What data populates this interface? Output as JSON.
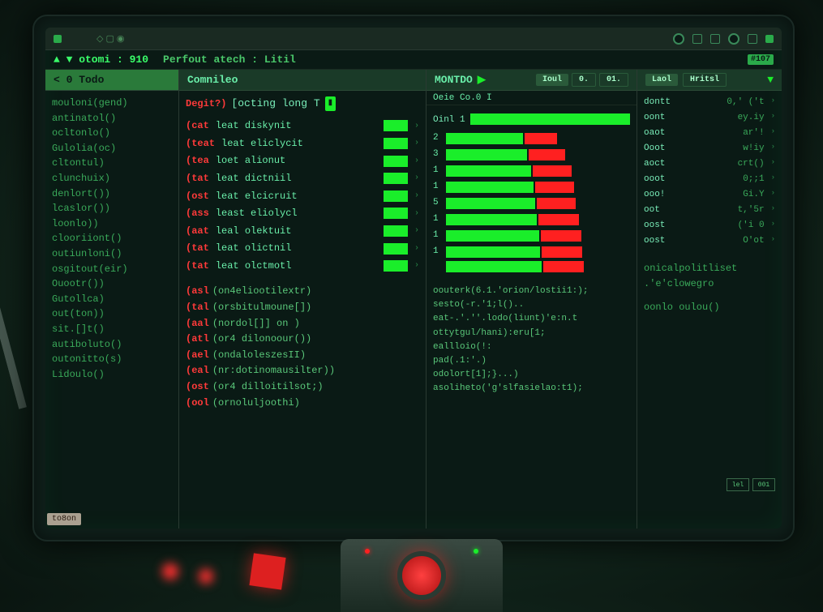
{
  "titlebar": {
    "icons": [
      "◇",
      "▢",
      "◉"
    ]
  },
  "statusbar": {
    "left": "▲ ▼ otomi : 910",
    "center": "Perfout atech : Litil",
    "badge": "#107"
  },
  "sidebar": {
    "header": "< 0 Todo",
    "items": [
      "mouloni(gend)",
      "antinatol()",
      "ocltonlo()",
      "Gulolia(oc)",
      "cltontul)",
      "clunchuix)",
      "denlort())",
      "lcaslor())",
      "loonlo))",
      "clooriiont()",
      "outiunloni()",
      "osgitout(eir)",
      "Ouootr())",
      "Gutollca)",
      "out(ton))",
      "sit.[]t()",
      "autiboluto()",
      "outonitto(s)",
      "Lidoulo()"
    ]
  },
  "center": {
    "header": "Comnileo",
    "banner_prefix": "Degit?)",
    "banner_text": "[octing long T",
    "tests": [
      {
        "tag": "(cat",
        "name": "leat diskynit"
      },
      {
        "tag": "(teat",
        "name": "leat eliclycit"
      },
      {
        "tag": "(tea",
        "name": "loet alionut"
      },
      {
        "tag": "(tat",
        "name": "leat dictniil"
      },
      {
        "tag": "(ost",
        "name": "leat elcicruit"
      },
      {
        "tag": "(ass",
        "name": "least eliolycl"
      },
      {
        "tag": "(aat",
        "name": "leal olektuit"
      },
      {
        "tag": "(tat",
        "name": "leat olictnil"
      },
      {
        "tag": "(tat",
        "name": "leat olctmotl"
      }
    ],
    "calls": [
      {
        "tag": "(asl",
        "name": "(on4eliootilextr)"
      },
      {
        "tag": "(tal",
        "name": "(orsbitulmoune[])"
      },
      {
        "tag": "(aal",
        "name": "(nordol[]] on )"
      },
      {
        "tag": "(atl",
        "name": "(or4 dilonoour())"
      },
      {
        "tag": "(ael",
        "name": "(ondaloleszesII)"
      },
      {
        "tag": "(eal",
        "name": "(nr:dotinomausilter))"
      },
      {
        "tag": "(ost",
        "name": "(or4 dilloitilsot;)"
      },
      {
        "tag": "(ool",
        "name": "(ornoluljoothi)"
      }
    ]
  },
  "monitor": {
    "header": "MONTDO",
    "tabs": [
      "Ioul",
      "0.",
      "01."
    ],
    "sub_label": "Oeie Co.0 I",
    "progress_label": "Oinl 1",
    "metrics": [
      {
        "id": "2",
        "g": 95,
        "r": 40
      },
      {
        "id": "3",
        "g": 100,
        "r": 45
      },
      {
        "id": "1",
        "g": 105,
        "r": 48
      },
      {
        "id": "1",
        "g": 108,
        "r": 48
      },
      {
        "id": "5",
        "g": 110,
        "r": 48
      },
      {
        "id": "1",
        "g": 112,
        "r": 50
      },
      {
        "id": "1",
        "g": 115,
        "r": 50
      },
      {
        "id": "1",
        "g": 116,
        "r": 50
      },
      {
        "id": "",
        "g": 118,
        "r": 50
      }
    ],
    "logs": [
      "oouterk(6.1.'orion/lostii1:);",
      "sesto(-r.'1;l()..",
      "eat-.'.''.lodo(liunt)'e:n.t",
      "ottytgul/hani):eru[1;",
      "eallloio(!:",
      "pad(.1:'.)",
      "odolort[1];}...)",
      "asoliheto('g'slfasielao:t1);"
    ]
  },
  "right": {
    "tabs": [
      "Laol",
      "Hritsl"
    ],
    "rows": [
      {
        "k": "dontt",
        "v": "0,' ('t"
      },
      {
        "k": "oont",
        "v": "ey.iy"
      },
      {
        "k": "oaot",
        "v": "ar'!"
      },
      {
        "k": "Ooot",
        "v": "w!iy"
      },
      {
        "k": "aoct",
        "v": "crt()"
      },
      {
        "k": "ooot",
        "v": "0;;1"
      },
      {
        "k": "ooo!",
        "v": "Gi.Y"
      },
      {
        "k": "oot",
        "v": "t,'5r"
      },
      {
        "k": "oost",
        "v": "('i 0"
      },
      {
        "k": "oost",
        "v": "O'ot"
      }
    ],
    "footer1": "onicalpolitliset",
    "footer2": ".'e'clowegro",
    "footer3": "oonlo oulou()"
  },
  "bottom_status": "to8on",
  "mini_boxes": [
    "lel",
    "001"
  ]
}
